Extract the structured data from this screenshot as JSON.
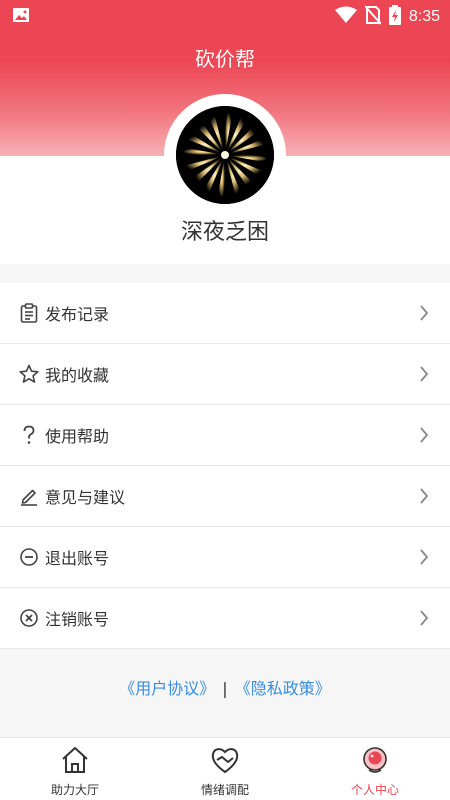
{
  "status_bar": {
    "time": "8:35",
    "icons": [
      "image-icon",
      "wifi-icon",
      "no-sim-icon",
      "battery-charging-icon"
    ]
  },
  "header": {
    "title": "砍价帮"
  },
  "profile": {
    "username": "深夜乏困",
    "avatar_icon": "avatar-image"
  },
  "menu": {
    "items": [
      {
        "label": "发布记录",
        "icon": "clipboard-icon"
      },
      {
        "label": "我的收藏",
        "icon": "star-icon"
      },
      {
        "label": "使用帮助",
        "icon": "question-icon"
      },
      {
        "label": "意见与建议",
        "icon": "pencil-icon"
      },
      {
        "label": "退出账号",
        "icon": "minus-circle-icon"
      },
      {
        "label": "注销账号",
        "icon": "close-circle-icon"
      }
    ]
  },
  "links": {
    "user_agreement": "《用户协议》",
    "separator": "|",
    "privacy_policy": "《隐私政策》"
  },
  "tabbar": {
    "tabs": [
      {
        "label": "助力大厅",
        "icon": "home-icon",
        "active": false
      },
      {
        "label": "情绪调配",
        "icon": "heart-hands-icon",
        "active": false
      },
      {
        "label": "个人中心",
        "icon": "user-center-icon",
        "active": true
      }
    ]
  },
  "colors": {
    "accent": "#ec4553",
    "link": "#3a8ee0",
    "background": "#f6f6f6"
  }
}
